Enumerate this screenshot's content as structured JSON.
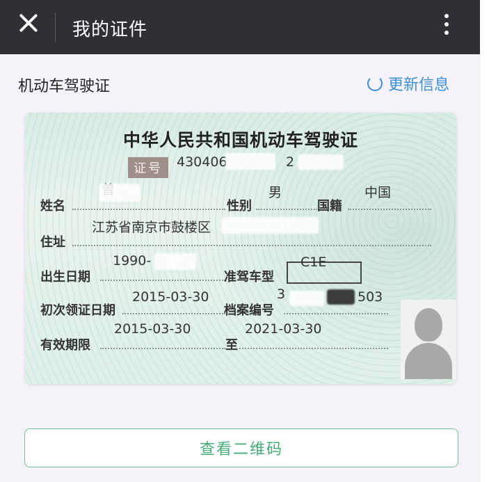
{
  "header": {
    "title": "我的证件"
  },
  "section": {
    "title": "机动车驾驶证",
    "refresh_label": "更新信息"
  },
  "card": {
    "title": "中华人民共和国机动车驾驶证",
    "id_badge": "证号",
    "id_number_start": "430406",
    "id_number_mid": "2",
    "labels": {
      "name": "姓名",
      "sex": "性别",
      "nationality": "国籍",
      "address": "住址",
      "birth_date": "出生日期",
      "vehicle_class": "准驾车型",
      "first_issue": "初次领证日期",
      "file_number": "档案编号",
      "valid_period": "有效期限",
      "to": "至"
    },
    "values": {
      "name_partial": "曾",
      "sex": "男",
      "nationality": "中国",
      "address": "江苏省南京市鼓楼区",
      "birth_date_partial": "1990-",
      "vehicle_class": "C1E",
      "first_issue": "2015-03-30",
      "file_number_start": "3",
      "file_number_end": "503",
      "valid_from": "2015-03-30",
      "valid_to": "2021-03-30"
    }
  },
  "actions": {
    "qr_button": "查看二维码"
  }
}
